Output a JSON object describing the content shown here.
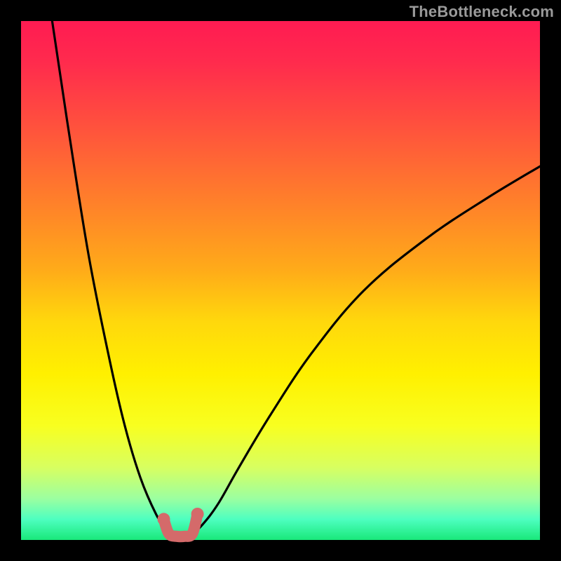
{
  "watermark": "TheBottleneck.com",
  "colors": {
    "frame": "#000000",
    "curve": "#000000",
    "marker": "#d46a6a",
    "gradient_top": "#ff1b52",
    "gradient_bottom": "#19e87a"
  },
  "chart_data": {
    "type": "line",
    "title": "",
    "xlabel": "",
    "ylabel": "",
    "xlim": [
      0,
      100
    ],
    "ylim": [
      0,
      100
    ],
    "notes": "V-shaped bottleneck curve over a vertical heat gradient. No axes, ticks, or legend are rendered. Values are estimated from pixel positions since no labels are shown.",
    "series": [
      {
        "name": "curve-left",
        "x": [
          6,
          9,
          13,
          17,
          20,
          23,
          26,
          27.5,
          29,
          30,
          31.5
        ],
        "y": [
          100,
          80,
          55,
          35,
          22,
          12,
          5,
          3,
          1.5,
          0.8,
          0.5
        ]
      },
      {
        "name": "curve-right",
        "x": [
          31.5,
          33,
          35,
          38,
          42,
          48,
          56,
          66,
          78,
          90,
          100
        ],
        "y": [
          0.5,
          1.2,
          3,
          7,
          14,
          24,
          36,
          48,
          58,
          66,
          72
        ]
      }
    ],
    "highlight_region": {
      "name": "valley-marker",
      "x": [
        27.5,
        28.5,
        30,
        31.5,
        33,
        34
      ],
      "y": [
        4,
        1.2,
        0.7,
        0.7,
        1.2,
        5
      ]
    }
  }
}
